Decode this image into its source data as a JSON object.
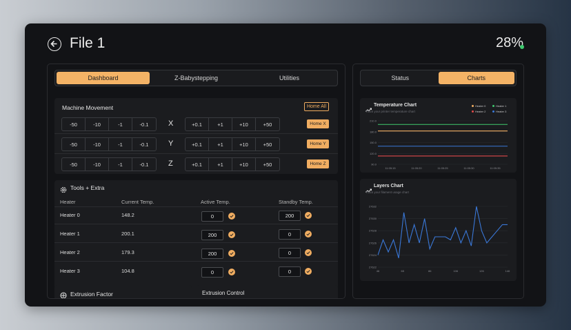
{
  "header": {
    "title": "File 1",
    "progress_text": "28%",
    "status_color": "#3fc96f"
  },
  "left_tabs": [
    "Dashboard",
    "Z-Babystepping",
    "Utilities"
  ],
  "right_tabs": [
    "Status",
    "Charts"
  ],
  "machine": {
    "title": "Machine Movement",
    "home_all": "Home All",
    "axes": [
      {
        "axis": "X",
        "neg": [
          "-50",
          "-10",
          "-1",
          "-0.1"
        ],
        "pos": [
          "+0.1",
          "+1",
          "+10",
          "+50"
        ],
        "home": "Home X"
      },
      {
        "axis": "Y",
        "neg": [
          "-50",
          "-10",
          "-1",
          "-0.1"
        ],
        "pos": [
          "+0.1",
          "+1",
          "+10",
          "+50"
        ],
        "home": "Home Y"
      },
      {
        "axis": "Z",
        "neg": [
          "-50",
          "-10",
          "-1",
          "-0.1"
        ],
        "pos": [
          "+0.1",
          "+1",
          "+10",
          "+50"
        ],
        "home": "Home Z"
      }
    ]
  },
  "tools": {
    "title": "Tools + Extra",
    "columns": [
      "Heater",
      "Current Temp.",
      "Active Temp.",
      "Standby Temp."
    ],
    "rows": [
      {
        "heater": "Heater 0",
        "current": "148.2",
        "active": "0",
        "standby": "200"
      },
      {
        "heater": "Heater 1",
        "current": "200.1",
        "active": "200",
        "standby": "0"
      },
      {
        "heater": "Heater 2",
        "current": "179.3",
        "active": "200",
        "standby": "0"
      },
      {
        "heater": "Heater 3",
        "current": "104.8",
        "active": "0",
        "standby": "0"
      }
    ]
  },
  "extrusion_factor": {
    "title": "Extrusion Factor"
  },
  "extrusion_control": {
    "title": "Extrusion Control"
  },
  "chart_data": [
    {
      "type": "line",
      "title": "Temperature Chart",
      "subtitle": "Track your printer temperature chart",
      "x": [
        "11:05:15",
        "11:05:20",
        "11:05:25",
        "11:05:30",
        "11:05:35"
      ],
      "y_ticks": [
        "210.0",
        "180.0",
        "150.0",
        "120.0",
        "90.0"
      ],
      "series": [
        {
          "name": "Heater 0",
          "color": "#f0ad61",
          "values": [
            182,
            182,
            182,
            182,
            182,
            182
          ]
        },
        {
          "name": "Heater 1",
          "color": "#3fc96f",
          "values": [
            200,
            200,
            200,
            200,
            200,
            200
          ]
        },
        {
          "name": "Heater 2",
          "color": "#e04a4a",
          "values": [
            113,
            113,
            113,
            113,
            113,
            113
          ]
        },
        {
          "name": "Heater 3",
          "color": "#3a78d8",
          "values": [
            140,
            140,
            140,
            140,
            140,
            140
          ]
        }
      ],
      "ylim": [
        90,
        210
      ],
      "grid": true,
      "legend": "top-right"
    },
    {
      "type": "line",
      "title": "Layers Chart",
      "subtitle": "Track your filament usage chart",
      "x_ticks": [
        "46",
        "65",
        "86",
        "106",
        "126",
        "146"
      ],
      "y_ticks": [
        "27632",
        "27630",
        "27628",
        "27626",
        "27624",
        "27622"
      ],
      "xlim": [
        46,
        146
      ],
      "ylim": [
        27622,
        27632
      ],
      "series": [
        {
          "color": "#3a78d8",
          "x": [
            46,
            50,
            54,
            58,
            62,
            66,
            70,
            74,
            78,
            82,
            86,
            90,
            94,
            98,
            102,
            106,
            110,
            114,
            118,
            122,
            126,
            130,
            134,
            138,
            142,
            146
          ],
          "values": [
            27624,
            27626.5,
            27624.5,
            27626.5,
            27623.5,
            27631,
            27626,
            27629,
            27626,
            27630,
            27625,
            27627,
            27627,
            27627,
            27626.5,
            27628.5,
            27626,
            27628,
            27625.5,
            27632,
            27628,
            27626,
            27627,
            27628,
            27629,
            27629
          ]
        }
      ],
      "grid": true
    }
  ]
}
